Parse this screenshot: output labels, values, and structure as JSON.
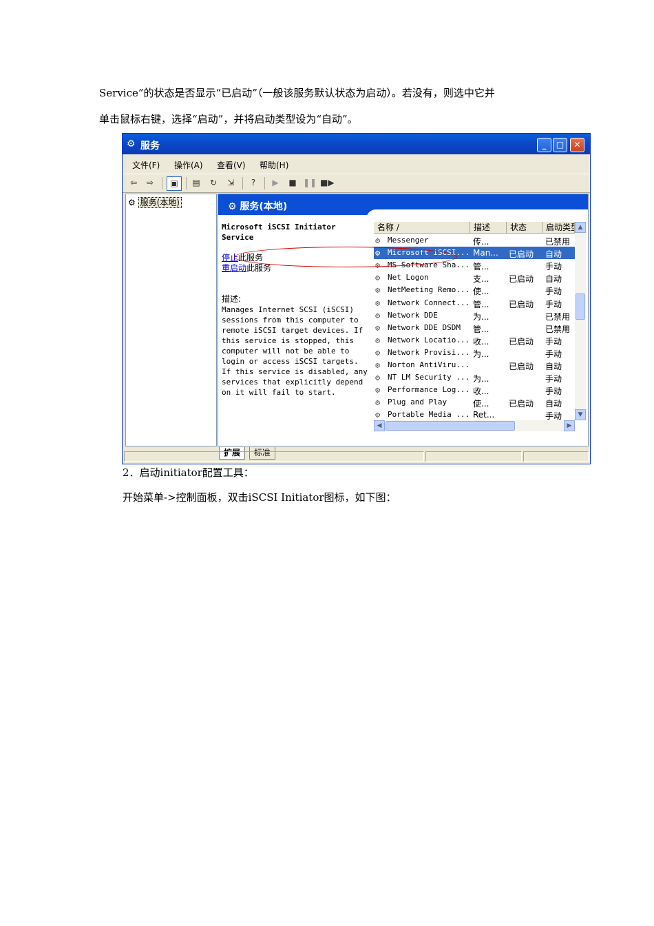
{
  "text": {
    "line1": "Service”的状态是否显示“已启动”（一般该服务默认状态为启动）。若没有，则选中它并",
    "line2": "单击鼠标右键，选择“启动”，并将启动类型设为“自动”。",
    "step2": "2．启动initiator配置工具：",
    "step2_detail": "开始菜单->控制面板，双击iSCSI Initiator图标，如下图："
  },
  "window": {
    "title": "服务",
    "menu": [
      "文件(F)",
      "操作(A)",
      "查看(V)",
      "帮助(H)"
    ],
    "tree_node": "服务(本地)",
    "banner": "服务(本地)",
    "selected_service": {
      "name_line1": "Microsoft iSCSI Initiator",
      "name_line2": "Service",
      "stop_link": "停止",
      "stop_suffix": "此服务",
      "restart_link": "重启动",
      "restart_suffix": "此服务",
      "desc_label": "描述:",
      "description": [
        "Manages Internet SCSI (iSCSI)",
        "sessions from this computer to",
        "remote iSCSI target devices. If",
        "this service is stopped, this",
        "computer will not be able to",
        "login or access iSCSI targets.",
        "If this service is disabled, any",
        "services that explicitly depend",
        "on it will fail to start."
      ]
    },
    "columns": [
      "名称 /",
      "描述",
      "状态",
      "启动类型"
    ],
    "rows": [
      {
        "name": "Messenger",
        "desc": "传...",
        "status": "",
        "start": "已禁用"
      },
      {
        "name": "Microsoft iSCSI...",
        "desc": "Man...",
        "status": "已启动",
        "start": "自动",
        "selected": true
      },
      {
        "name": "MS Software Sha...",
        "desc": "管...",
        "status": "",
        "start": "手动"
      },
      {
        "name": "Net Logon",
        "desc": "支...",
        "status": "已启动",
        "start": "自动"
      },
      {
        "name": "NetMeeting Remo...",
        "desc": "使...",
        "status": "",
        "start": "手动"
      },
      {
        "name": "Network Connect...",
        "desc": "管...",
        "status": "已启动",
        "start": "手动"
      },
      {
        "name": "Network DDE",
        "desc": "为...",
        "status": "",
        "start": "已禁用"
      },
      {
        "name": "Network DDE DSDM",
        "desc": "管...",
        "status": "",
        "start": "已禁用"
      },
      {
        "name": "Network Locatio...",
        "desc": "收...",
        "status": "已启动",
        "start": "手动"
      },
      {
        "name": "Network Provisi...",
        "desc": "为...",
        "status": "",
        "start": "手动"
      },
      {
        "name": "Norton AntiViru...",
        "desc": "",
        "status": "已启动",
        "start": "自动"
      },
      {
        "name": "NT LM Security ...",
        "desc": "为...",
        "status": "",
        "start": "手动"
      },
      {
        "name": "Performance Log...",
        "desc": "收...",
        "status": "",
        "start": "手动"
      },
      {
        "name": "Plug and Play",
        "desc": "使...",
        "status": "已启动",
        "start": "自动"
      },
      {
        "name": "Portable Media ...",
        "desc": "Ret...",
        "status": "",
        "start": "手动"
      }
    ],
    "tabs": [
      "扩展",
      "标准"
    ]
  },
  "icons": {
    "service": "gear-icon",
    "back": "back-arrow-icon",
    "forward": "forward-arrow-icon",
    "play": "play-icon",
    "stop": "stop-icon",
    "pause": "pause-icon",
    "restart": "restart-icon"
  },
  "colors": {
    "titlebar": "#0b46c8",
    "selection": "#316ac5",
    "annotation_oval": "#d40000"
  }
}
